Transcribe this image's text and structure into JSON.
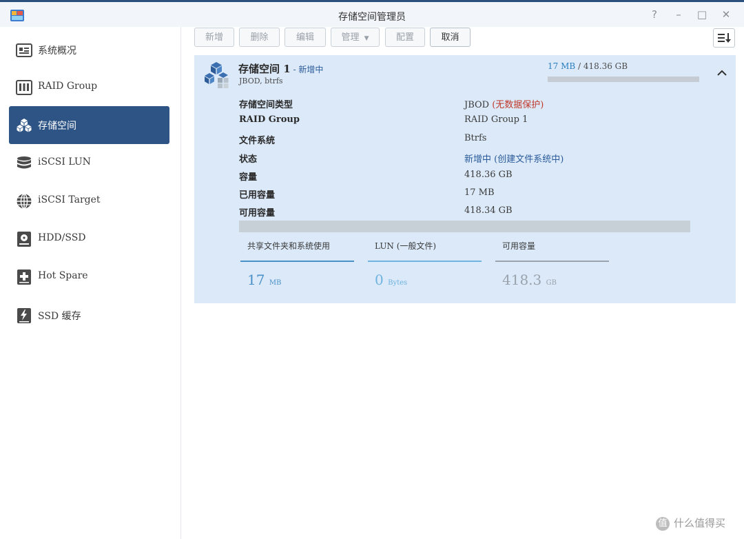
{
  "window": {
    "title": "存储空间管理员",
    "controls": {
      "help": "?",
      "minimize": "–",
      "maximize": "□",
      "close": "✕"
    }
  },
  "sidebar": {
    "items": [
      {
        "label": "系统概况",
        "icon": "overview-icon",
        "active": false
      },
      {
        "label": "RAID Group",
        "icon": "raid-group-icon",
        "active": false
      },
      {
        "label": "存储空间",
        "icon": "storage-space-icon",
        "active": true
      },
      {
        "label": "iSCSI LUN",
        "icon": "iscsi-lun-icon",
        "active": false
      },
      {
        "label": "iSCSI Target",
        "icon": "iscsi-target-icon",
        "active": false
      },
      {
        "label": "HDD/SSD",
        "icon": "hdd-ssd-icon",
        "active": false
      },
      {
        "label": "Hot Spare",
        "icon": "hot-spare-icon",
        "active": false
      },
      {
        "label": "SSD 缓存",
        "icon": "ssd-cache-icon",
        "active": false
      }
    ]
  },
  "toolbar": {
    "new": "新增",
    "delete": "删除",
    "edit": "编辑",
    "manage": "管理",
    "configure": "配置",
    "cancel": "取消"
  },
  "volume": {
    "name": "存储空间 1",
    "status_inline": " - 新增中",
    "subtitle": "JBOD, btrfs",
    "usage_used": "17 MB",
    "usage_total": " / 418.36 GB",
    "usage_fraction": 0.0,
    "properties": {
      "type_label": "存储空间类型",
      "type_value": "JBOD",
      "type_warning": "(无数据保护)",
      "raid_label": "RAID Group",
      "raid_value": "RAID Group 1",
      "fs_label": "文件系统",
      "fs_value": "Btrfs",
      "status_label": "状态",
      "status_value": "新增中 (创建文件系统中)",
      "capacity_label": "容量",
      "capacity_value": "418.36 GB",
      "used_label": "已用容量",
      "used_value": "17 MB",
      "free_label": "可用容量",
      "free_value": "418.34 GB"
    },
    "capacity_breakdown": [
      {
        "title": "共享文件夹和系统使用",
        "value": "17",
        "unit": "MB",
        "color": "#4a90c8"
      },
      {
        "title": "LUN (一般文件)",
        "value": "0",
        "unit": "Bytes",
        "color": "#6fb3e0"
      },
      {
        "title": "可用容量",
        "value": "418.3",
        "unit": "GB",
        "color": "#9aa3ad"
      }
    ]
  },
  "watermark": {
    "badge": "值",
    "text": "什么值得买"
  }
}
